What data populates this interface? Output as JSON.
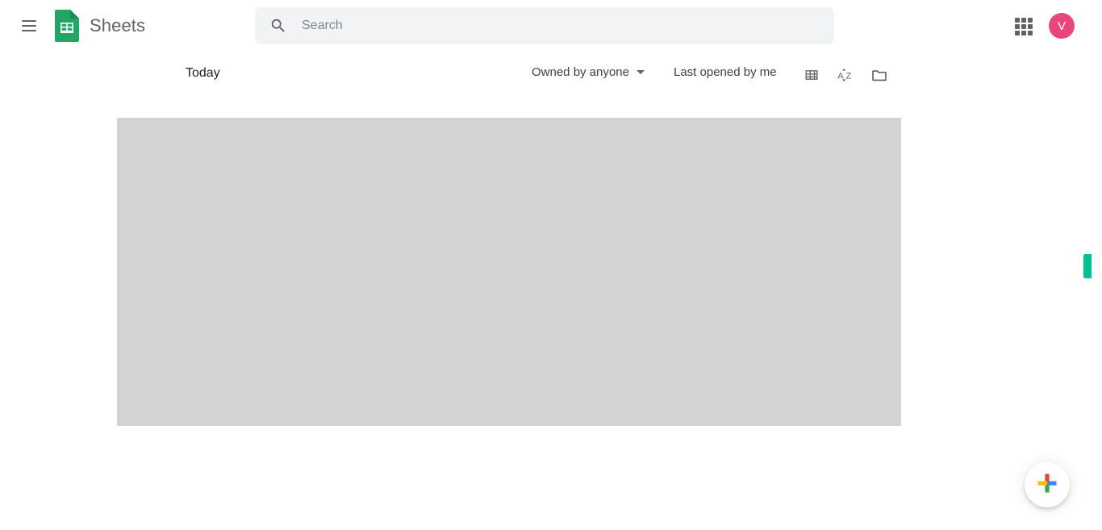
{
  "app": {
    "title": "Sheets",
    "logo_icon": "sheets-icon",
    "menu_icon": "hamburger-menu-icon"
  },
  "search": {
    "placeholder": "Search",
    "value": "",
    "icon": "search-icon"
  },
  "account": {
    "apps_icon": "apps-grid-icon",
    "avatar_initial": "V",
    "avatar_color": "#e8467c"
  },
  "toolbar": {
    "section_label": "Today",
    "owner_filter": "Owned by anyone",
    "owner_filter_caret": "chevron-down-icon",
    "sort_label": "Last opened by me",
    "grid_view_icon": "grid-view-icon",
    "sort_az_icon": "sort-alpha-icon",
    "folder_icon": "folder-icon"
  },
  "main": {
    "placeholder_color": "#d3d3d3"
  },
  "edge_tab": {
    "color": "#00c194"
  },
  "fab": {
    "icon": "google-plus-icon",
    "colors": {
      "top": "#ea4335",
      "right": "#4285f4",
      "bottom": "#34a853",
      "left": "#fbbc04"
    }
  }
}
